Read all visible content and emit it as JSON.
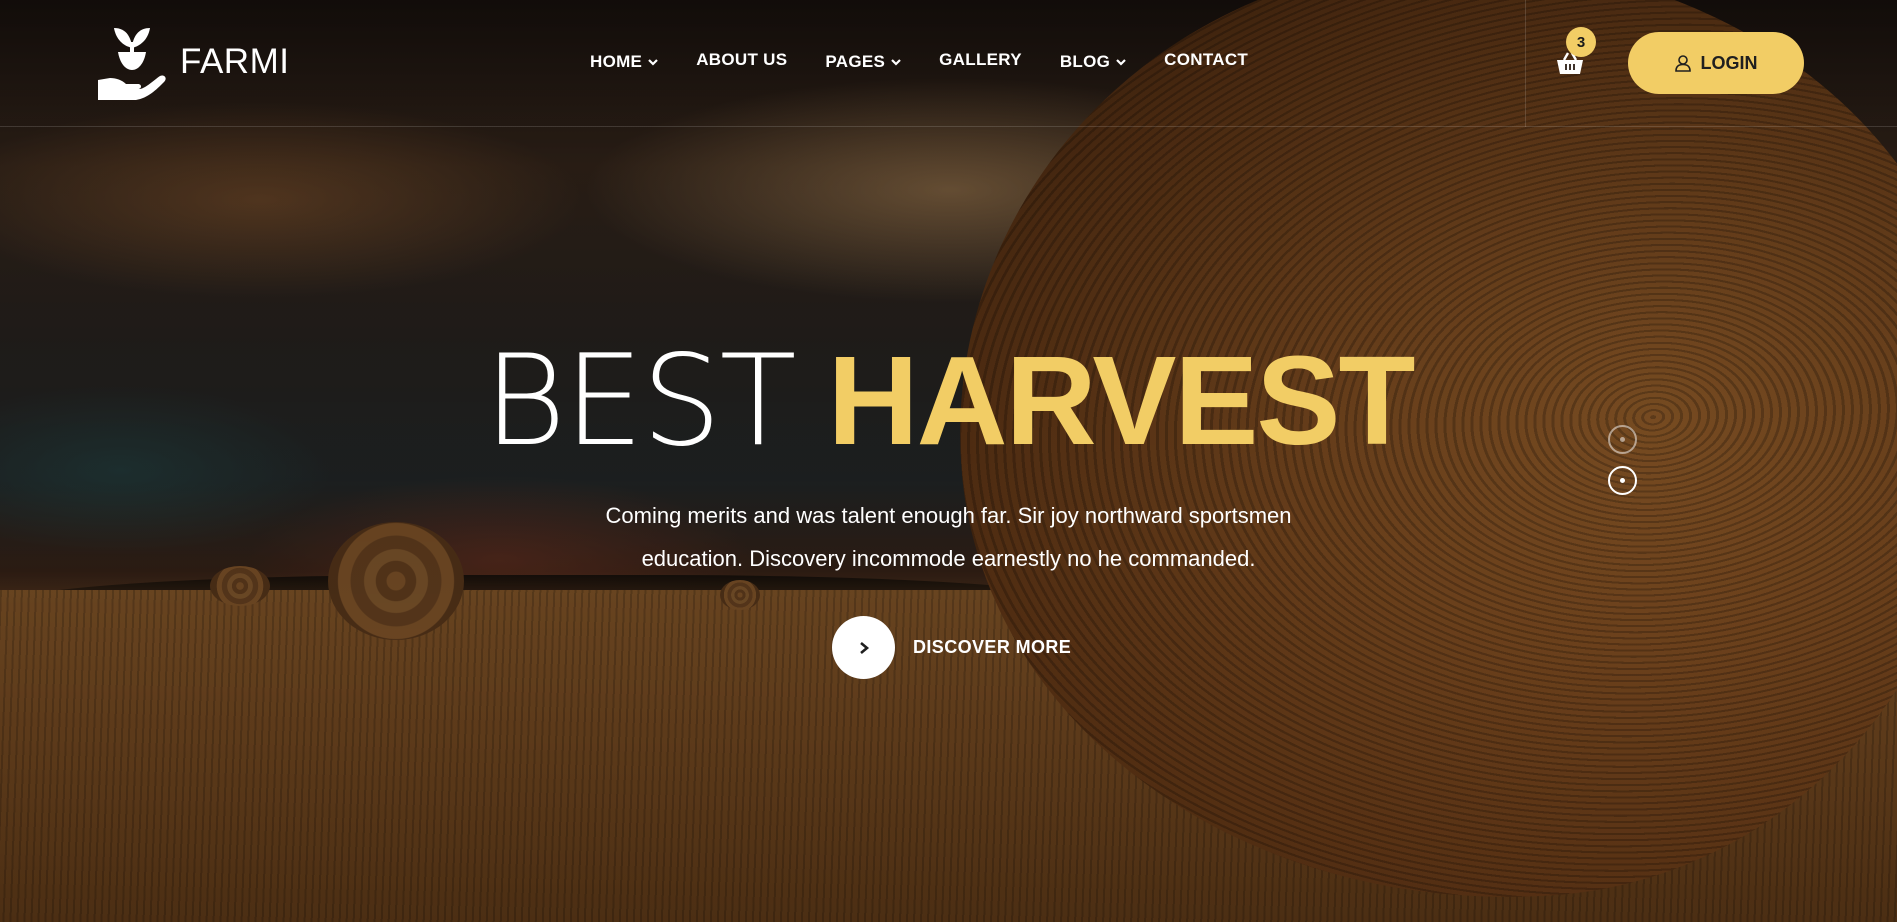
{
  "brand": {
    "name": "FARMI",
    "accent": "#f2cd65"
  },
  "nav": {
    "items": [
      {
        "label": "HOME",
        "has_dropdown": true
      },
      {
        "label": "ABOUT US",
        "has_dropdown": false
      },
      {
        "label": "PAGES",
        "has_dropdown": true
      },
      {
        "label": "GALLERY",
        "has_dropdown": false
      },
      {
        "label": "BLOG",
        "has_dropdown": true
      },
      {
        "label": "CONTACT",
        "has_dropdown": false
      }
    ]
  },
  "cart": {
    "icon": "basket-icon",
    "count": "3"
  },
  "login": {
    "label": "LOGIN",
    "icon": "user-icon"
  },
  "hero": {
    "headline_light": "BEST",
    "headline_bold": "HARVEST",
    "text_line1": "Coming merits and was talent enough far. Sir joy northward sportsmen",
    "text_line2": "education. Discovery incommode earnestly no he commanded.",
    "cta_label": "DISCOVER MORE",
    "cta_icon": "chevron-right-icon"
  },
  "slider": {
    "slides": 2,
    "active_index": 1
  }
}
